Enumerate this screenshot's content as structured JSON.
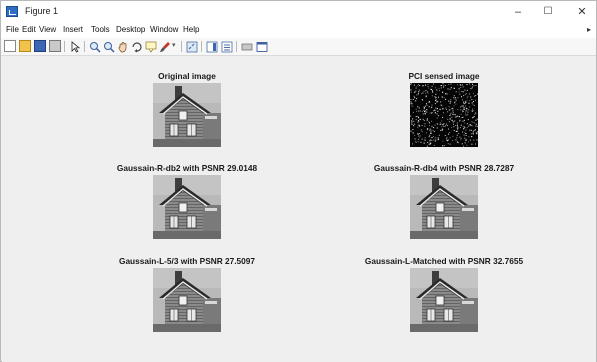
{
  "window": {
    "title": "Figure 1",
    "controls": [
      "–",
      "☐",
      "✕"
    ]
  },
  "menu": {
    "items": [
      "File",
      "Edit",
      "View",
      "Insert",
      "Tools",
      "Desktop",
      "Window",
      "Help"
    ],
    "overflow_arrow": "▸"
  },
  "toolbar": {
    "icons": [
      "new-figure-icon",
      "open-file-icon",
      "save-icon",
      "print-icon",
      "edit-plot-icon",
      "zoom-in-icon",
      "zoom-out-icon",
      "pan-icon",
      "rotate-3d-icon",
      "data-cursor-icon",
      "brush-icon",
      "link-icon",
      "colorbar-icon",
      "legend-icon",
      "hide-plot-tools-icon",
      "show-plot-tools-icon"
    ]
  },
  "figure": {
    "panels": [
      {
        "title": "Original image",
        "image": "house-grayscale"
      },
      {
        "title": "PCI sensed image",
        "image": "noise-measurement"
      },
      {
        "title": "Gaussain-R-db2 with PSNR 29.0148",
        "image": "house-grayscale"
      },
      {
        "title": "Gaussain-R-db4 with PSNR 28.7287",
        "image": "house-grayscale"
      },
      {
        "title": "Gaussain-L-5/3 with PSNR 27.5097",
        "image": "house-grayscale"
      },
      {
        "title": "Gaussain-L-Matched with PSNR 32.7655",
        "image": "house-grayscale"
      }
    ]
  },
  "colors": {
    "canvas": "#efefef",
    "titlebar": "#ffffff",
    "toolbar": "#f7f7f7"
  }
}
